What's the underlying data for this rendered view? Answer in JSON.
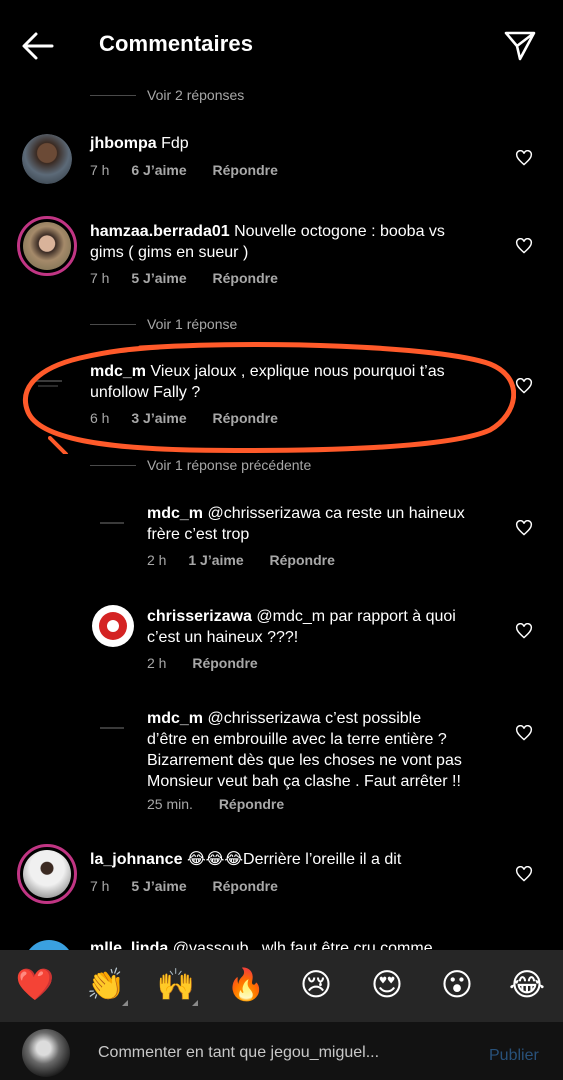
{
  "header": {
    "title": "Commentaires"
  },
  "threads": {
    "view_replies_1": "Voir 2 réponses",
    "view_replies_2": "Voir 1 réponse",
    "view_previous": "Voir 1 réponse précédente"
  },
  "comments": [
    {
      "user": "jhbompa",
      "text": "Fdp",
      "text_lines": [
        "Fdp"
      ],
      "time": "7 h",
      "likes": "6 J’aime",
      "reply": "Répondre"
    },
    {
      "user": "hamzaa.berrada01",
      "text": "Nouvelle octogone : booba vs gims ( gims en sueur )",
      "line1": "Nouvelle octogone : booba vs",
      "line2": "gims ( gims en sueur )",
      "time": "7 h",
      "likes": "5 J’aime",
      "reply": "Répondre"
    },
    {
      "user": "mdc_m",
      "line1": "Vieux jaloux , explique nous pourquoi t’as",
      "line2": "unfollow Fally ?",
      "time": "6 h",
      "likes": "3 J’aime",
      "reply": "Répondre"
    },
    {
      "user": "mdc_m",
      "line1": "@chrisserizawa ca reste un haineux",
      "line2": "frère c’est trop",
      "time": "2 h",
      "likes": "1 J’aime",
      "reply": "Répondre"
    },
    {
      "user": "chrisserizawa",
      "line1": "@mdc_m par rapport à quoi",
      "line2": "c’est un haineux ???!",
      "time": "2 h",
      "reply": "Répondre"
    },
    {
      "user": "mdc_m",
      "line1": "@chrisserizawa c’est possible",
      "line2": "d’être en embrouille avec la terre entière ?",
      "line3": "Bizarrement dès que les choses ne vont pas",
      "line4": "Monsieur veut bah ça clashe . Faut arrêter !!",
      "time": "25 min.",
      "reply": "Répondre"
    },
    {
      "user": "la_johnance",
      "text": "😂😂😂Derrière l’oreille il a dit",
      "time": "7 h",
      "likes": "5 J’aime",
      "reply": "Répondre"
    },
    {
      "user": "mlle_linda",
      "text": "@vassoub_ wlh faut être cru comme"
    }
  ],
  "emoji_bar": {
    "e1": "❤️",
    "e2": "👏",
    "e3": "🙌",
    "e4": "🔥",
    "e5": "😢",
    "e6": "😍",
    "e7": "😮",
    "e8": "😂"
  },
  "composer": {
    "placeholder": "Commenter en tant que jegou_miguel...",
    "post_label": "Publier"
  },
  "colors": {
    "background": "#000000",
    "secondary_text": "#a8a8a8",
    "annotation": "#ff5a2a",
    "story_ring": "#c13584",
    "post_disabled": "#28517a"
  }
}
